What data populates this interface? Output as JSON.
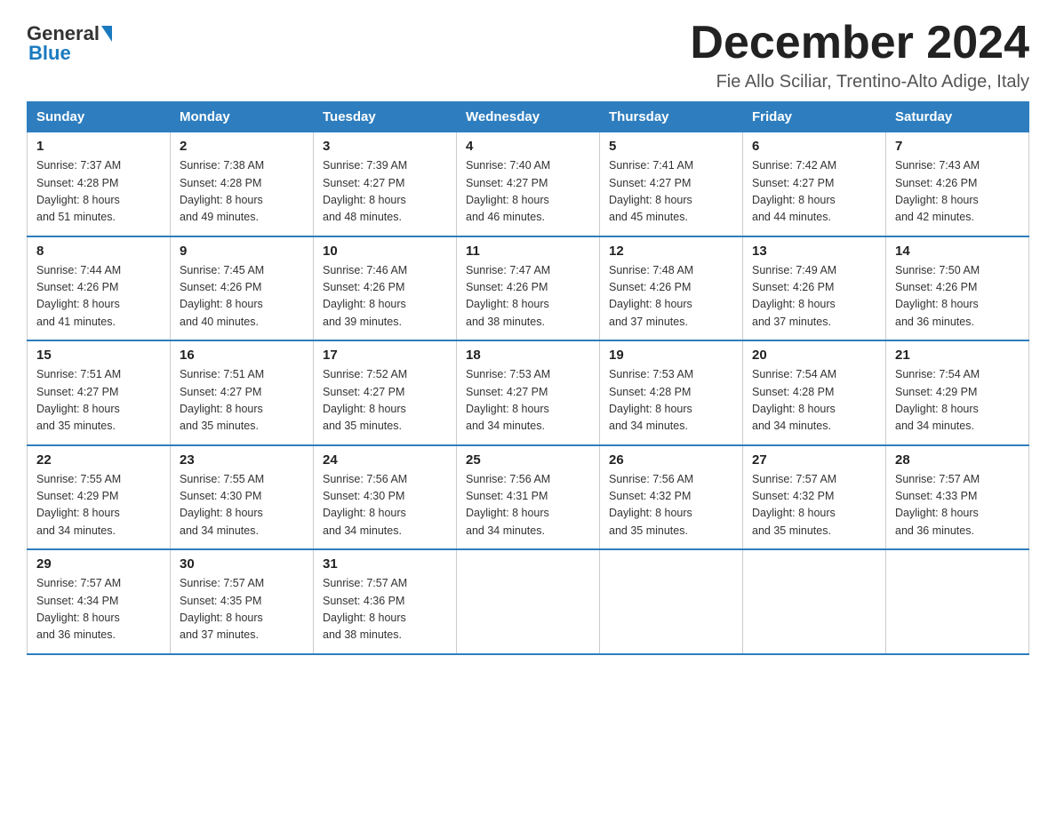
{
  "header": {
    "logo": {
      "general": "General",
      "blue": "Blue"
    },
    "title": "December 2024",
    "subtitle": "Fie Allo Sciliar, Trentino-Alto Adige, Italy"
  },
  "days_of_week": [
    "Sunday",
    "Monday",
    "Tuesday",
    "Wednesday",
    "Thursday",
    "Friday",
    "Saturday"
  ],
  "weeks": [
    [
      {
        "day": "1",
        "sunrise": "7:37 AM",
        "sunset": "4:28 PM",
        "daylight": "8 hours and 51 minutes."
      },
      {
        "day": "2",
        "sunrise": "7:38 AM",
        "sunset": "4:28 PM",
        "daylight": "8 hours and 49 minutes."
      },
      {
        "day": "3",
        "sunrise": "7:39 AM",
        "sunset": "4:27 PM",
        "daylight": "8 hours and 48 minutes."
      },
      {
        "day": "4",
        "sunrise": "7:40 AM",
        "sunset": "4:27 PM",
        "daylight": "8 hours and 46 minutes."
      },
      {
        "day": "5",
        "sunrise": "7:41 AM",
        "sunset": "4:27 PM",
        "daylight": "8 hours and 45 minutes."
      },
      {
        "day": "6",
        "sunrise": "7:42 AM",
        "sunset": "4:27 PM",
        "daylight": "8 hours and 44 minutes."
      },
      {
        "day": "7",
        "sunrise": "7:43 AM",
        "sunset": "4:26 PM",
        "daylight": "8 hours and 42 minutes."
      }
    ],
    [
      {
        "day": "8",
        "sunrise": "7:44 AM",
        "sunset": "4:26 PM",
        "daylight": "8 hours and 41 minutes."
      },
      {
        "day": "9",
        "sunrise": "7:45 AM",
        "sunset": "4:26 PM",
        "daylight": "8 hours and 40 minutes."
      },
      {
        "day": "10",
        "sunrise": "7:46 AM",
        "sunset": "4:26 PM",
        "daylight": "8 hours and 39 minutes."
      },
      {
        "day": "11",
        "sunrise": "7:47 AM",
        "sunset": "4:26 PM",
        "daylight": "8 hours and 38 minutes."
      },
      {
        "day": "12",
        "sunrise": "7:48 AM",
        "sunset": "4:26 PM",
        "daylight": "8 hours and 37 minutes."
      },
      {
        "day": "13",
        "sunrise": "7:49 AM",
        "sunset": "4:26 PM",
        "daylight": "8 hours and 37 minutes."
      },
      {
        "day": "14",
        "sunrise": "7:50 AM",
        "sunset": "4:26 PM",
        "daylight": "8 hours and 36 minutes."
      }
    ],
    [
      {
        "day": "15",
        "sunrise": "7:51 AM",
        "sunset": "4:27 PM",
        "daylight": "8 hours and 35 minutes."
      },
      {
        "day": "16",
        "sunrise": "7:51 AM",
        "sunset": "4:27 PM",
        "daylight": "8 hours and 35 minutes."
      },
      {
        "day": "17",
        "sunrise": "7:52 AM",
        "sunset": "4:27 PM",
        "daylight": "8 hours and 35 minutes."
      },
      {
        "day": "18",
        "sunrise": "7:53 AM",
        "sunset": "4:27 PM",
        "daylight": "8 hours and 34 minutes."
      },
      {
        "day": "19",
        "sunrise": "7:53 AM",
        "sunset": "4:28 PM",
        "daylight": "8 hours and 34 minutes."
      },
      {
        "day": "20",
        "sunrise": "7:54 AM",
        "sunset": "4:28 PM",
        "daylight": "8 hours and 34 minutes."
      },
      {
        "day": "21",
        "sunrise": "7:54 AM",
        "sunset": "4:29 PM",
        "daylight": "8 hours and 34 minutes."
      }
    ],
    [
      {
        "day": "22",
        "sunrise": "7:55 AM",
        "sunset": "4:29 PM",
        "daylight": "8 hours and 34 minutes."
      },
      {
        "day": "23",
        "sunrise": "7:55 AM",
        "sunset": "4:30 PM",
        "daylight": "8 hours and 34 minutes."
      },
      {
        "day": "24",
        "sunrise": "7:56 AM",
        "sunset": "4:30 PM",
        "daylight": "8 hours and 34 minutes."
      },
      {
        "day": "25",
        "sunrise": "7:56 AM",
        "sunset": "4:31 PM",
        "daylight": "8 hours and 34 minutes."
      },
      {
        "day": "26",
        "sunrise": "7:56 AM",
        "sunset": "4:32 PM",
        "daylight": "8 hours and 35 minutes."
      },
      {
        "day": "27",
        "sunrise": "7:57 AM",
        "sunset": "4:32 PM",
        "daylight": "8 hours and 35 minutes."
      },
      {
        "day": "28",
        "sunrise": "7:57 AM",
        "sunset": "4:33 PM",
        "daylight": "8 hours and 36 minutes."
      }
    ],
    [
      {
        "day": "29",
        "sunrise": "7:57 AM",
        "sunset": "4:34 PM",
        "daylight": "8 hours and 36 minutes."
      },
      {
        "day": "30",
        "sunrise": "7:57 AM",
        "sunset": "4:35 PM",
        "daylight": "8 hours and 37 minutes."
      },
      {
        "day": "31",
        "sunrise": "7:57 AM",
        "sunset": "4:36 PM",
        "daylight": "8 hours and 38 minutes."
      },
      null,
      null,
      null,
      null
    ]
  ],
  "labels": {
    "sunrise": "Sunrise:",
    "sunset": "Sunset:",
    "daylight": "Daylight:"
  }
}
